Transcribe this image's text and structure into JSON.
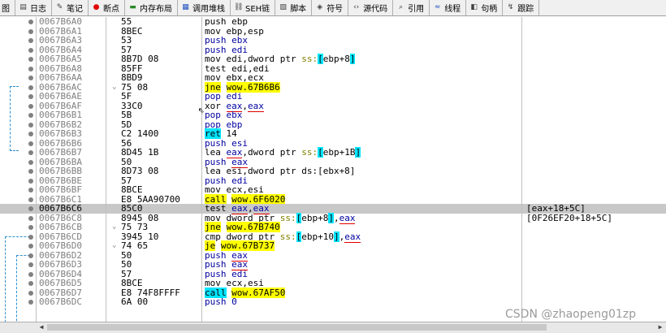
{
  "tabs": [
    {
      "label": "图",
      "icon": ""
    },
    {
      "label": "日志",
      "icon": "log-icon"
    },
    {
      "label": "笔记",
      "icon": "notes-icon"
    },
    {
      "label": "断点",
      "icon": "breakpoint-icon"
    },
    {
      "label": "内存布局",
      "icon": "memory-map-icon"
    },
    {
      "label": "调用堆栈",
      "icon": "call-stack-icon"
    },
    {
      "label": "SEH链",
      "icon": "seh-icon"
    },
    {
      "label": "脚本",
      "icon": "script-icon"
    },
    {
      "label": "符号",
      "icon": "symbols-icon"
    },
    {
      "label": "源代码",
      "icon": "source-icon"
    },
    {
      "label": "引用",
      "icon": "references-icon"
    },
    {
      "label": "线程",
      "icon": "threads-icon"
    },
    {
      "label": "句柄",
      "icon": "handles-icon"
    },
    {
      "label": "跟踪",
      "icon": "trace-icon"
    }
  ],
  "rows": [
    {
      "addr": "0067B6A0",
      "bytes": "55",
      "asm": [
        [
          "t",
          "push ebp"
        ]
      ]
    },
    {
      "addr": "0067B6A1",
      "bytes": "8BEC",
      "asm": [
        [
          "t",
          "mov ebp,esp"
        ]
      ]
    },
    {
      "addr": "0067B6A3",
      "bytes": "53",
      "asm": [
        [
          "b",
          "push ebx"
        ]
      ]
    },
    {
      "addr": "0067B6A4",
      "bytes": "57",
      "asm": [
        [
          "b",
          "push edi"
        ]
      ]
    },
    {
      "addr": "0067B6A5",
      "bytes": "8B7D 08",
      "asm": [
        [
          "t",
          "mov edi,dword ptr "
        ],
        [
          "s",
          "ss:"
        ],
        [
          "k",
          "["
        ],
        [
          "t",
          "ebp+8"
        ],
        [
          "k",
          "]"
        ]
      ]
    },
    {
      "addr": "0067B6A8",
      "bytes": "85FF",
      "asm": [
        [
          "t",
          "test edi,edi"
        ]
      ]
    },
    {
      "addr": "0067B6AA",
      "bytes": "8BD9",
      "asm": [
        [
          "t",
          "mov ebx,ecx"
        ]
      ]
    },
    {
      "addr": "0067B6AC",
      "bytes": "75 08",
      "arrow": "⌄",
      "asm": [
        [
          "y",
          "jne"
        ],
        [
          "t",
          " "
        ],
        [
          "y",
          "wow.67B6B6"
        ]
      ]
    },
    {
      "addr": "0067B6AE",
      "bytes": "5F",
      "asm": [
        [
          "b",
          "pop edi"
        ]
      ]
    },
    {
      "addr": "0067B6AF",
      "bytes": "33C0",
      "asm": [
        [
          "t",
          "xor "
        ],
        [
          "u",
          "eax"
        ],
        [
          "t",
          ","
        ],
        [
          "u",
          "eax"
        ]
      ]
    },
    {
      "addr": "0067B6B1",
      "bytes": "5B",
      "asm": [
        [
          "b",
          "pop ebx"
        ]
      ]
    },
    {
      "addr": "0067B6B2",
      "bytes": "5D",
      "asm": [
        [
          "b",
          "pop ebp"
        ]
      ]
    },
    {
      "addr": "0067B6B3",
      "bytes": "C2 1400",
      "asm": [
        [
          "c",
          "ret"
        ],
        [
          "t",
          " 14"
        ]
      ]
    },
    {
      "addr": "0067B6B6",
      "bytes": "56",
      "asm": [
        [
          "b",
          "push esi"
        ]
      ]
    },
    {
      "addr": "0067B6B7",
      "bytes": "8D45 1B",
      "asm": [
        [
          "t",
          "lea "
        ],
        [
          "u",
          "eax"
        ],
        [
          "t",
          ",dword ptr "
        ],
        [
          "s",
          "ss:"
        ],
        [
          "k",
          "["
        ],
        [
          "t",
          "ebp+1B"
        ],
        [
          "k",
          "]"
        ]
      ]
    },
    {
      "addr": "0067B6BA",
      "bytes": "50",
      "asm": [
        [
          "b",
          "push "
        ],
        [
          "u",
          "eax"
        ]
      ]
    },
    {
      "addr": "0067B6BB",
      "bytes": "8D73 08",
      "asm": [
        [
          "t",
          "lea esi,dword ptr ds:[ebx+8]"
        ]
      ]
    },
    {
      "addr": "0067B6BE",
      "bytes": "57",
      "asm": [
        [
          "b",
          "push edi"
        ]
      ]
    },
    {
      "addr": "0067B6BF",
      "bytes": "8BCE",
      "asm": [
        [
          "t",
          "mov ecx,esi"
        ]
      ]
    },
    {
      "addr": "0067B6C1",
      "bytes": "E8 5AA90700",
      "asm": [
        [
          "y",
          "call"
        ],
        [
          "t",
          " "
        ],
        [
          "y",
          "wow.6F6020"
        ]
      ]
    },
    {
      "addr": "0067B6C6",
      "bytes": "85C0",
      "sel": true,
      "asm": [
        [
          "t",
          "test "
        ],
        [
          "u",
          "eax"
        ],
        [
          "t",
          ","
        ],
        [
          "u",
          "eax"
        ]
      ],
      "cmt": "[eax+18+5C]"
    },
    {
      "addr": "0067B6C8",
      "bytes": "8945 08",
      "asm": [
        [
          "t",
          "mov dword ptr "
        ],
        [
          "s",
          "ss:"
        ],
        [
          "k",
          "["
        ],
        [
          "t",
          "ebp+8"
        ],
        [
          "k",
          "]"
        ],
        [
          "t",
          ","
        ],
        [
          "u",
          "eax"
        ]
      ],
      "cmt": "[0F26EF20+18+5C]"
    },
    {
      "addr": "0067B6CB",
      "bytes": "75 73",
      "arrow": "⌄",
      "asm": [
        [
          "y",
          "jne"
        ],
        [
          "t",
          " "
        ],
        [
          "y",
          "wow.67B740"
        ]
      ]
    },
    {
      "addr": "0067B6CD",
      "bytes": "3945 10",
      "asm": [
        [
          "t",
          "cmp dword ptr "
        ],
        [
          "s",
          "ss:"
        ],
        [
          "k",
          "["
        ],
        [
          "t",
          "ebp+10"
        ],
        [
          "k",
          "]"
        ],
        [
          "t",
          ","
        ],
        [
          "u",
          "eax"
        ]
      ]
    },
    {
      "addr": "0067B6D0",
      "bytes": "74 65",
      "arrow": "⌄",
      "asm": [
        [
          "y",
          "je"
        ],
        [
          "t",
          " "
        ],
        [
          "y",
          "wow.67B737"
        ]
      ]
    },
    {
      "addr": "0067B6D2",
      "bytes": "50",
      "asm": [
        [
          "b",
          "push "
        ],
        [
          "u",
          "eax"
        ]
      ]
    },
    {
      "addr": "0067B6D3",
      "bytes": "50",
      "asm": [
        [
          "b",
          "push "
        ],
        [
          "u",
          "eax"
        ]
      ]
    },
    {
      "addr": "0067B6D4",
      "bytes": "57",
      "asm": [
        [
          "b",
          "push edi"
        ]
      ]
    },
    {
      "addr": "0067B6D5",
      "bytes": "8BCE",
      "asm": [
        [
          "t",
          "mov ecx,esi"
        ]
      ]
    },
    {
      "addr": "0067B6D7",
      "bytes": "E8 74F8FFFF",
      "asm": [
        [
          "c",
          "call"
        ],
        [
          "t",
          " "
        ],
        [
          "y",
          "wow.67AF50"
        ]
      ]
    },
    {
      "addr": "0067B6DC",
      "bytes": "6A 00",
      "asm": [
        [
          "b",
          "push 0"
        ]
      ]
    }
  ],
  "watermark": "CSDN @zhaopeng01zp",
  "colors": {
    "jump": "#2e8fd0",
    "yellow": "#ffff00",
    "cyan": "#00e5ff",
    "selected_row": "#c8c8c8"
  }
}
